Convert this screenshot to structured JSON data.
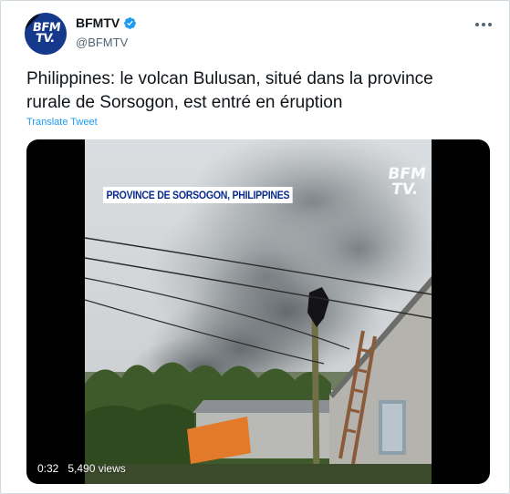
{
  "account": {
    "display_name": "BFMTV",
    "handle": "@BFMTV",
    "avatar_text_line1": "BFM",
    "avatar_text_line2": "TV."
  },
  "tweet": {
    "text_line1": "Philippines: le volcan Bulusan, situé dans la province",
    "text_line2": "rurale de Sorsogon, est entré en éruption",
    "translate_label": "Translate Tweet"
  },
  "video": {
    "caption": "PROVINCE DE SORSOGON, PHILIPPINES",
    "watermark_line1": "BFM",
    "watermark_line2": "TV.",
    "duration": "0:32",
    "views": "5,490 views"
  },
  "icons": {
    "verified": "verified-badge-icon",
    "more": "more-options-icon"
  },
  "colors": {
    "accent": "#1d9bf0",
    "brand": "#15398c",
    "caption_text": "#0a2c8a"
  }
}
